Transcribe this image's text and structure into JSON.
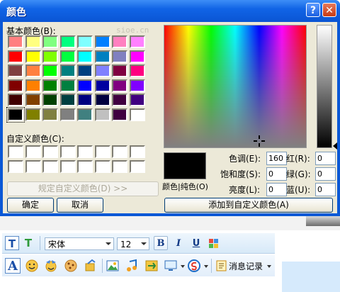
{
  "dialog": {
    "title": "颜色",
    "help_button": "?",
    "close_button": "✕",
    "basic_colors_label": "基本颜色(B):",
    "custom_colors_label": "自定义颜色(C):",
    "watermark": "sioe.cn",
    "define_custom_button": "规定自定义颜色(D) >>",
    "ok_button": "确定",
    "cancel_button": "取消",
    "add_custom_button": "添加到自定义颜色(A)",
    "color_solid_label": "颜色|纯色(O)",
    "selected_color": "#000000",
    "basic_colors": [
      [
        "#ff8080",
        "#ffff80",
        "#80ff80",
        "#00ff80",
        "#80ffff",
        "#0080ff",
        "#ff80c0",
        "#ff80ff"
      ],
      [
        "#ff0000",
        "#ffff00",
        "#80ff00",
        "#00ff40",
        "#00ffff",
        "#0080c0",
        "#8080c0",
        "#ff00ff"
      ],
      [
        "#804040",
        "#ff8040",
        "#00ff00",
        "#008080",
        "#004080",
        "#8080ff",
        "#800040",
        "#ff0080"
      ],
      [
        "#800000",
        "#ff8000",
        "#008000",
        "#008040",
        "#0000ff",
        "#0000a0",
        "#800080",
        "#8000ff"
      ],
      [
        "#400000",
        "#804000",
        "#004000",
        "#004040",
        "#000080",
        "#000040",
        "#400040",
        "#400080"
      ],
      [
        "#000000",
        "#808000",
        "#808040",
        "#808080",
        "#408080",
        "#c0c0c0",
        "#400040",
        "#ffffff"
      ]
    ],
    "fields": {
      "hue": {
        "label": "色调(E):",
        "value": "160"
      },
      "sat": {
        "label": "饱和度(S):",
        "value": "0"
      },
      "lum": {
        "label": "亮度(L):",
        "value": "0"
      },
      "red": {
        "label": "红(R):",
        "value": "0"
      },
      "green": {
        "label": "绿(G):",
        "value": "0"
      },
      "blue": {
        "label": "蓝(U):",
        "value": "0"
      }
    }
  },
  "chat": {
    "font_name": "宋体",
    "font_size": "12",
    "bold": "B",
    "italic": "I",
    "underline": "U",
    "text_icon": "T",
    "font_icon": "A",
    "history_label": "消息记录"
  },
  "colors": {
    "title_blue": "#0a58d6",
    "dialog_bg": "#ece9d8"
  }
}
